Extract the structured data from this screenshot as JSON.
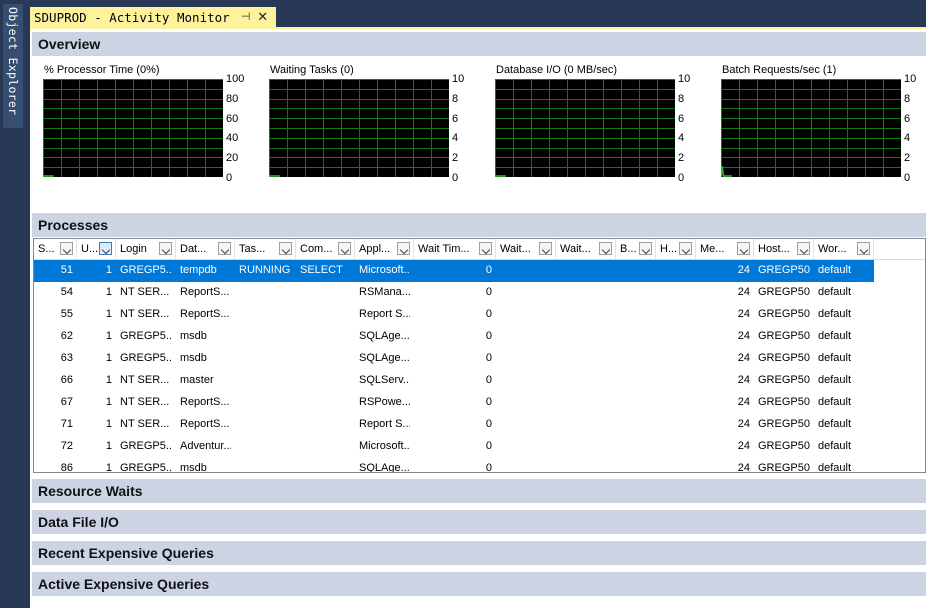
{
  "side_panel": {
    "label": "Object Explorer"
  },
  "tab": {
    "title": "SDUPROD - Activity Monitor",
    "pin_glyph": "⊣",
    "close_glyph": "✕"
  },
  "sections": {
    "overview": "Overview",
    "processes": "Processes",
    "resource_waits": "Resource Waits",
    "data_file_io": "Data File I/O",
    "recent_expensive": "Recent Expensive Queries",
    "active_expensive": "Active Expensive Queries"
  },
  "charts": [
    {
      "title": "% Processor Time (0%)",
      "ticks": [
        "100",
        "80",
        "60",
        "40",
        "20",
        "0"
      ]
    },
    {
      "title": "Waiting Tasks (0)",
      "ticks": [
        "10",
        "8",
        "6",
        "4",
        "2",
        "0"
      ]
    },
    {
      "title": "Database I/O (0 MB/sec)",
      "ticks": [
        "10",
        "8",
        "6",
        "4",
        "2",
        "0"
      ]
    },
    {
      "title": "Batch Requests/sec (1)",
      "ticks": [
        "10",
        "8",
        "6",
        "4",
        "2",
        "0"
      ]
    }
  ],
  "chart_data": [
    {
      "type": "line",
      "title": "% Processor Time (0%)",
      "ylim": [
        0,
        100
      ],
      "series": [
        {
          "values": [
            0,
            0,
            0,
            0,
            0,
            0,
            0,
            0,
            0,
            0
          ]
        }
      ],
      "grid": true
    },
    {
      "type": "line",
      "title": "Waiting Tasks (0)",
      "ylim": [
        0,
        10
      ],
      "series": [
        {
          "values": [
            0,
            0,
            0,
            0,
            0,
            0,
            0,
            0,
            0,
            0
          ]
        }
      ],
      "grid": true
    },
    {
      "type": "line",
      "title": "Database I/O (0 MB/sec)",
      "ylim": [
        0,
        10
      ],
      "series": [
        {
          "values": [
            0,
            0,
            0,
            0,
            0,
            0,
            0,
            0,
            0,
            0
          ]
        }
      ],
      "grid": true
    },
    {
      "type": "line",
      "title": "Batch Requests/sec (1)",
      "ylim": [
        0,
        10
      ],
      "series": [
        {
          "values": [
            0,
            1,
            0,
            0,
            0,
            0,
            0,
            0,
            0,
            0
          ]
        }
      ],
      "grid": true
    }
  ],
  "grid": {
    "columns": [
      "S...",
      "U...",
      "Login",
      "Dat...",
      "Tas...",
      "Com...",
      "Appl...",
      "Wait Tim...",
      "Wait...",
      "Wait...",
      "B...",
      "H...",
      "Me...",
      "Host...",
      "Wor..."
    ],
    "rows": [
      [
        "51",
        "1",
        "GREGP5...",
        "tempdb",
        "RUNNING",
        "SELECT",
        "Microsoft...",
        "0",
        "",
        "",
        "",
        "",
        "24",
        "GREGP50",
        "default"
      ],
      [
        "54",
        "1",
        "NT SER...",
        "ReportS...",
        "",
        "",
        "RSMana...",
        "0",
        "",
        "",
        "",
        "",
        "24",
        "GREGP50",
        "default"
      ],
      [
        "55",
        "1",
        "NT SER...",
        "ReportS...",
        "",
        "",
        "Report S...",
        "0",
        "",
        "",
        "",
        "",
        "24",
        "GREGP50",
        "default"
      ],
      [
        "62",
        "1",
        "GREGP5...",
        "msdb",
        "",
        "",
        "SQLAge...",
        "0",
        "",
        "",
        "",
        "",
        "24",
        "GREGP50",
        "default"
      ],
      [
        "63",
        "1",
        "GREGP5...",
        "msdb",
        "",
        "",
        "SQLAge...",
        "0",
        "",
        "",
        "",
        "",
        "24",
        "GREGP50",
        "default"
      ],
      [
        "66",
        "1",
        "NT SER...",
        "master",
        "",
        "",
        "SQLServ...",
        "0",
        "",
        "",
        "",
        "",
        "24",
        "GREGP50",
        "default"
      ],
      [
        "67",
        "1",
        "NT SER...",
        "ReportS...",
        "",
        "",
        "RSPowe...",
        "0",
        "",
        "",
        "",
        "",
        "24",
        "GREGP50",
        "default"
      ],
      [
        "71",
        "1",
        "NT SER...",
        "ReportS...",
        "",
        "",
        "Report S...",
        "0",
        "",
        "",
        "",
        "",
        "24",
        "GREGP50",
        "default"
      ],
      [
        "72",
        "1",
        "GREGP5...",
        "Adventur...",
        "",
        "",
        "Microsoft...",
        "0",
        "",
        "",
        "",
        "",
        "24",
        "GREGP50",
        "default"
      ],
      [
        "86",
        "1",
        "GREGP5...",
        "msdb",
        "",
        "",
        "SQLAge...",
        "0",
        "",
        "",
        "",
        "",
        "24",
        "GREGP50",
        "default"
      ]
    ],
    "selected_row": 0
  },
  "colors": {
    "accent": "#0078d7",
    "tab": "#fff29d",
    "chart_grid": "#0e7a10",
    "chart_line": "#28c828"
  },
  "icons": [
    "pin-icon",
    "close-icon",
    "column-filter-dropdown-icon"
  ]
}
